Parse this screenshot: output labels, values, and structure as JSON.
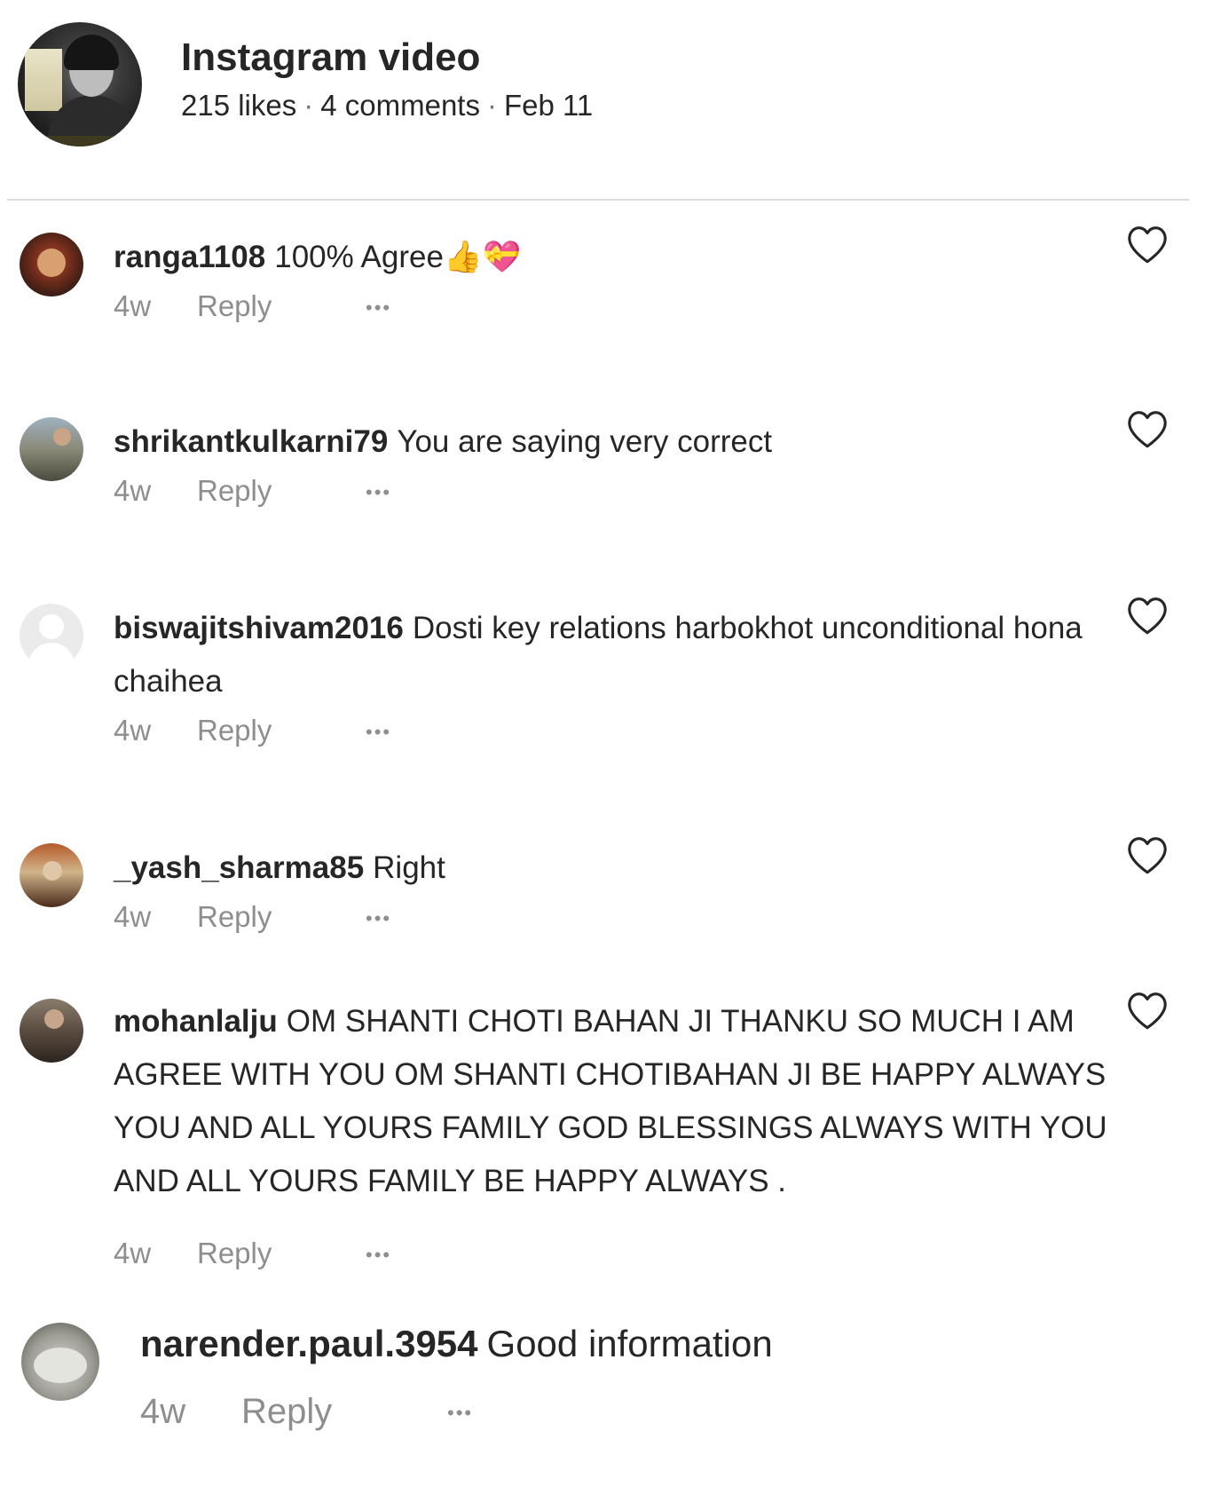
{
  "post": {
    "title": "Instagram video",
    "likes": "215 likes",
    "comments_count": "4 comments",
    "date": "Feb 11",
    "separator": "·"
  },
  "comments": [
    {
      "username": "ranga1108",
      "text": "100% Agree👍💝",
      "time": "4w",
      "reply_label": "Reply",
      "more_label": "•••"
    },
    {
      "username": "shrikantkulkarni79",
      "text": "You are saying very correct",
      "time": "4w",
      "reply_label": "Reply",
      "more_label": "•••"
    },
    {
      "username": "biswajitshivam2016",
      "text": "Dosti key relations harbokhot unconditional hona chaihea",
      "time": "4w",
      "reply_label": "Reply",
      "more_label": "•••"
    },
    {
      "username": "_yash_sharma85",
      "text": "Right",
      "time": "4w",
      "reply_label": "Reply",
      "more_label": "•••"
    },
    {
      "username": "mohanlalju",
      "text": "OM SHANTI CHOTI BAHAN JI THANKU SO MUCH I AM AGREE WITH YOU OM SHANTI CHOTIBAHAN JI BE HAPPY ALWAYS YOU AND ALL YOURS FAMILY GOD BLESSINGS ALWAYS WITH YOU AND ALL YOURS FAMILY BE HAPPY ALWAYS .",
      "time": "4w",
      "reply_label": "Reply",
      "more_label": "•••"
    },
    {
      "username": "narender.paul.3954",
      "text": "Good information",
      "time": "4w",
      "reply_label": "Reply",
      "more_label": "•••"
    }
  ],
  "icons": {
    "like": "heart-icon",
    "more": "more-options-icon"
  },
  "colors": {
    "text_primary": "#262626",
    "text_secondary": "#8e8e8e",
    "divider": "#dbdbdb"
  }
}
